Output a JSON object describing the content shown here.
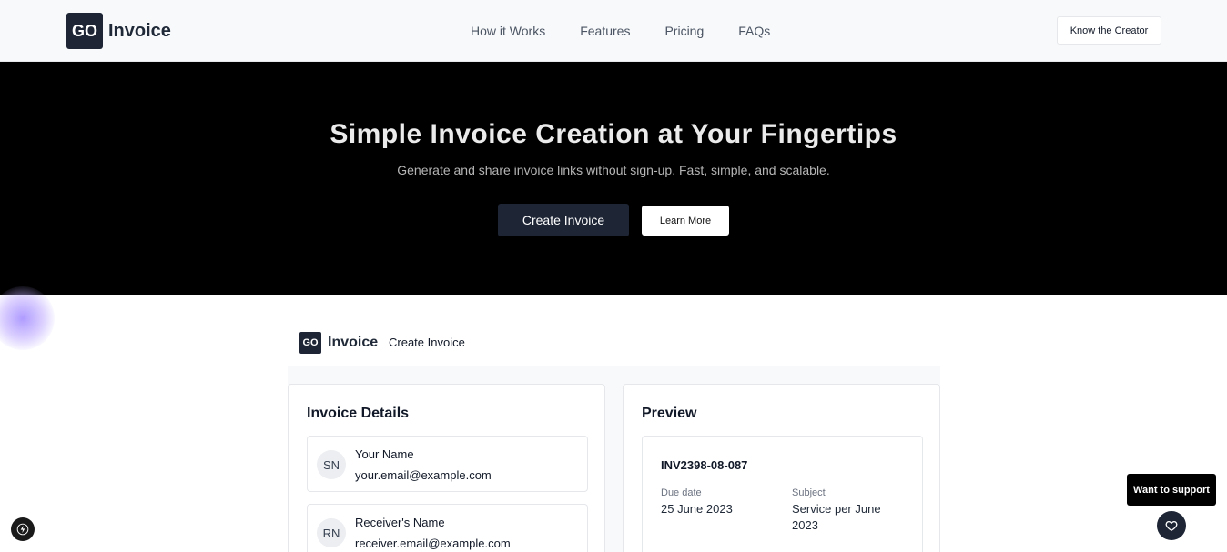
{
  "header": {
    "logo_badge": "GO",
    "logo_text": "Invoice",
    "nav": [
      "How it Works",
      "Features",
      "Pricing",
      "FAQs"
    ],
    "creator_label": "Know the Creator"
  },
  "hero": {
    "title": "Simple Invoice Creation at Your Fingertips",
    "subtitle": "Generate and share invoice links without sign-up. Fast, simple, and scalable.",
    "primary_label": "Create Invoice",
    "secondary_label": "Learn More"
  },
  "app": {
    "logo_badge": "GO",
    "logo_text": "Invoice",
    "page_title": "Create Invoice",
    "details": {
      "title": "Invoice Details",
      "sender": {
        "initials": "SN",
        "name": "Your Name",
        "email": "your.email@example.com"
      },
      "receiver": {
        "initials": "RN",
        "name": "Receiver's Name",
        "email": "receiver.email@example.com"
      }
    },
    "preview": {
      "title": "Preview",
      "invoice_number": "INV2398-08-087",
      "due_label": "Due date",
      "due_value": "25 June 2023",
      "subject_label": "Subject",
      "subject_value": "Service per June 2023"
    }
  },
  "floating": {
    "support_label": "Want to support",
    "heart_icon": "heart-icon",
    "bolt_icon": "lightning-icon"
  },
  "colors": {
    "brand_dark": "#1e2535",
    "hero_bg": "#000000",
    "page_bg": "#f8f9fb"
  }
}
